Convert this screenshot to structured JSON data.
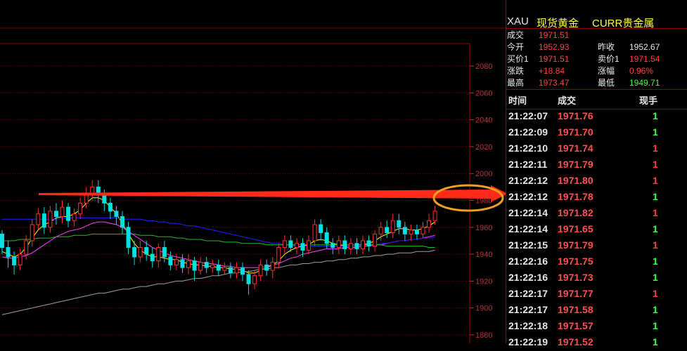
{
  "chart_data": {
    "type": "candlestick",
    "ylim": [
      1880,
      2100
    ],
    "yticks": [
      "2080",
      "2060",
      "2040",
      "2020",
      "2000",
      "1980",
      "1960",
      "1940",
      "1920",
      "1900",
      "1880"
    ],
    "grid": true,
    "candles": [
      [
        1955,
        1945,
        1958,
        1940
      ],
      [
        1945,
        1938,
        1950,
        1930
      ],
      [
        1938,
        1932,
        1942,
        1925
      ],
      [
        1932,
        1940,
        1944,
        1928
      ],
      [
        1940,
        1950,
        1954,
        1936
      ],
      [
        1950,
        1962,
        1966,
        1946
      ],
      [
        1962,
        1970,
        1974,
        1958
      ],
      [
        1970,
        1960,
        1975,
        1955
      ],
      [
        1960,
        1972,
        1976,
        1956
      ],
      [
        1972,
        1968,
        1978,
        1962
      ],
      [
        1968,
        1975,
        1980,
        1963
      ],
      [
        1975,
        1965,
        1978,
        1960
      ],
      [
        1965,
        1970,
        1974,
        1961
      ],
      [
        1970,
        1978,
        1982,
        1966
      ],
      [
        1978,
        1985,
        1990,
        1974
      ],
      [
        1985,
        1990,
        1995,
        1980
      ],
      [
        1990,
        1984,
        1995,
        1978
      ],
      [
        1984,
        1978,
        1988,
        1972
      ],
      [
        1978,
        1972,
        1982,
        1966
      ],
      [
        1972,
        1968,
        1976,
        1962
      ],
      [
        1968,
        1960,
        1972,
        1955
      ],
      [
        1960,
        1945,
        1964,
        1940
      ],
      [
        1945,
        1938,
        1950,
        1932
      ],
      [
        1938,
        1945,
        1950,
        1934
      ],
      [
        1945,
        1940,
        1950,
        1935
      ],
      [
        1940,
        1935,
        1945,
        1930
      ],
      [
        1935,
        1945,
        1948,
        1930
      ],
      [
        1945,
        1938,
        1950,
        1934
      ],
      [
        1938,
        1932,
        1942,
        1928
      ],
      [
        1932,
        1936,
        1940,
        1928
      ],
      [
        1936,
        1930,
        1940,
        1926
      ],
      [
        1930,
        1935,
        1940,
        1925
      ],
      [
        1935,
        1928,
        1938,
        1920
      ],
      [
        1928,
        1934,
        1938,
        1925
      ],
      [
        1934,
        1930,
        1938,
        1926
      ],
      [
        1930,
        1932,
        1936,
        1926
      ],
      [
        1932,
        1928,
        1936,
        1924
      ],
      [
        1928,
        1930,
        1934,
        1925
      ],
      [
        1930,
        1926,
        1934,
        1922
      ],
      [
        1926,
        1930,
        1934,
        1922
      ],
      [
        1930,
        1925,
        1934,
        1920
      ],
      [
        1925,
        1918,
        1928,
        1910
      ],
      [
        1918,
        1924,
        1928,
        1914
      ],
      [
        1924,
        1932,
        1936,
        1920
      ],
      [
        1932,
        1928,
        1936,
        1924
      ],
      [
        1928,
        1934,
        1938,
        1922
      ],
      [
        1934,
        1945,
        1948,
        1930
      ],
      [
        1945,
        1950,
        1954,
        1940
      ],
      [
        1950,
        1945,
        1954,
        1942
      ],
      [
        1945,
        1948,
        1952,
        1940
      ],
      [
        1948,
        1943,
        1952,
        1938
      ],
      [
        1943,
        1950,
        1954,
        1940
      ],
      [
        1950,
        1962,
        1966,
        1946
      ],
      [
        1962,
        1956,
        1966,
        1950
      ],
      [
        1956,
        1948,
        1960,
        1944
      ],
      [
        1948,
        1945,
        1952,
        1940
      ],
      [
        1945,
        1950,
        1954,
        1940
      ],
      [
        1950,
        1944,
        1954,
        1940
      ],
      [
        1944,
        1948,
        1952,
        1940
      ],
      [
        1948,
        1944,
        1952,
        1940
      ],
      [
        1944,
        1950,
        1954,
        1940
      ],
      [
        1950,
        1946,
        1954,
        1942
      ],
      [
        1946,
        1955,
        1958,
        1942
      ],
      [
        1955,
        1960,
        1964,
        1950
      ],
      [
        1960,
        1956,
        1965,
        1952
      ],
      [
        1956,
        1965,
        1970,
        1952
      ],
      [
        1965,
        1960,
        1970,
        1955
      ],
      [
        1960,
        1955,
        1964,
        1950
      ],
      [
        1955,
        1958,
        1962,
        1950
      ],
      [
        1958,
        1955,
        1962,
        1951
      ],
      [
        1955,
        1960,
        1964,
        1952
      ],
      [
        1960,
        1965,
        1970,
        1956
      ],
      [
        1965,
        1972,
        1976,
        1962
      ]
    ],
    "series": [
      {
        "color": "#ffff00",
        "values": [
          1942,
          1940,
          1938,
          1940,
          1945,
          1952,
          1958,
          1962,
          1964,
          1967,
          1968,
          1968,
          1970,
          1973,
          1978,
          1982,
          1982,
          1980,
          1975,
          1970,
          1963,
          1955,
          1948,
          1943,
          1940,
          1938,
          1938,
          1937,
          1936,
          1936,
          1934,
          1933,
          1932,
          1932,
          1931,
          1931,
          1930,
          1930,
          1929,
          1929,
          1928,
          1926,
          1926,
          1928,
          1930,
          1932,
          1935,
          1940,
          1943,
          1945,
          1946,
          1947,
          1950,
          1951,
          1950,
          1948,
          1947,
          1946,
          1946,
          1946,
          1947,
          1948,
          1950,
          1953,
          1955,
          1957,
          1959,
          1959,
          1958,
          1958,
          1959,
          1961,
          1964
        ]
      },
      {
        "color": "#ff40ff",
        "values": [
          1938,
          1937,
          1937,
          1938,
          1939,
          1941,
          1944,
          1947,
          1950,
          1953,
          1955,
          1957,
          1958,
          1959,
          1961,
          1963,
          1964,
          1964,
          1963,
          1962,
          1960,
          1957,
          1954,
          1951,
          1948,
          1945,
          1943,
          1941,
          1939,
          1938,
          1937,
          1936,
          1935,
          1934,
          1933,
          1933,
          1932,
          1931,
          1931,
          1930,
          1930,
          1930,
          1930,
          1930,
          1931,
          1932,
          1933,
          1935,
          1937,
          1938,
          1940,
          1941,
          1942,
          1943,
          1944,
          1944,
          1944,
          1945,
          1945,
          1945,
          1946,
          1946,
          1947,
          1947,
          1948,
          1949,
          1950,
          1950,
          1951,
          1951,
          1952,
          1953,
          1954
        ]
      },
      {
        "color": "#2020ff",
        "values": [
          1966,
          1966,
          1966,
          1966,
          1966,
          1966,
          1966,
          1966,
          1966,
          1966,
          1967,
          1967,
          1967,
          1967,
          1967,
          1967,
          1967,
          1967,
          1967,
          1967,
          1966,
          1966,
          1966,
          1966,
          1965,
          1965,
          1964,
          1964,
          1963,
          1963,
          1962,
          1961,
          1961,
          1960,
          1959,
          1958,
          1957,
          1956,
          1955,
          1954,
          1953,
          1952,
          1951,
          1950,
          1949,
          1948,
          1948,
          1947,
          1947,
          1946,
          1946,
          1946,
          1946,
          1946,
          1946,
          1946,
          1946,
          1946,
          1946,
          1946,
          1947,
          1947,
          1947,
          1948,
          1948,
          1949,
          1950,
          1950,
          1951,
          1951,
          1952,
          1952,
          1953
        ]
      },
      {
        "color": "#20c020",
        "values": [
          1950,
          1950,
          1950,
          1951,
          1951,
          1951,
          1952,
          1952,
          1952,
          1953,
          1953,
          1953,
          1954,
          1954,
          1954,
          1955,
          1955,
          1955,
          1955,
          1955,
          1955,
          1955,
          1955,
          1954,
          1954,
          1954,
          1953,
          1953,
          1953,
          1952,
          1952,
          1951,
          1951,
          1951,
          1950,
          1950,
          1950,
          1949,
          1949,
          1949,
          1948,
          1948,
          1948,
          1948,
          1947,
          1947,
          1947,
          1947,
          1947,
          1947,
          1947,
          1947,
          1947,
          1947,
          1947,
          1947,
          1947,
          1947,
          1947,
          1947,
          1947,
          1947,
          1947,
          1947,
          1946,
          1946,
          1946,
          1946,
          1946,
          1946,
          1946,
          1945,
          1945
        ]
      },
      {
        "color": "#a0a0a0",
        "values": [
          1895,
          1896,
          1897,
          1898,
          1899,
          1900,
          1901,
          1902,
          1903,
          1904,
          1905,
          1906,
          1907,
          1908,
          1909,
          1910,
          1911,
          1911,
          1912,
          1913,
          1914,
          1914,
          1915,
          1916,
          1916,
          1917,
          1918,
          1918,
          1919,
          1920,
          1920,
          1921,
          1922,
          1922,
          1923,
          1924,
          1924,
          1925,
          1926,
          1926,
          1927,
          1927,
          1928,
          1929,
          1929,
          1930,
          1930,
          1931,
          1932,
          1932,
          1933,
          1933,
          1934,
          1934,
          1935,
          1935,
          1936,
          1936,
          1937,
          1937,
          1938,
          1938,
          1939,
          1939,
          1940,
          1940,
          1941,
          1941,
          1941,
          1942,
          1942,
          1942,
          1943
        ]
      }
    ]
  },
  "quote": {
    "symbol": "XAU",
    "name": "现货黄金",
    "category": "CURR贵金属",
    "last_label": "成交",
    "last": "1971.51",
    "open_label": "今开",
    "open": "1952.93",
    "prev_label": "昨收",
    "prev": "1952.67",
    "bid_label": "买价1",
    "bid": "1971.51",
    "ask_label": "卖价1",
    "ask": "1971.54",
    "change_label": "涨跌",
    "change": "+18.84",
    "pct_label": "涨幅",
    "pct": "0.96%",
    "high_label": "最高",
    "high": "1973.47",
    "low_label": "最低",
    "low": "1949.71"
  },
  "ticks_header": {
    "time": "时间",
    "price": "成交",
    "vol": "现手"
  },
  "ticks": [
    {
      "time": "21:22:07",
      "price": "1971.76",
      "vol": "1",
      "dir": "green"
    },
    {
      "time": "21:22:09",
      "price": "1971.70",
      "vol": "1",
      "dir": "green"
    },
    {
      "time": "21:22:10",
      "price": "1971.74",
      "vol": "1",
      "dir": "red"
    },
    {
      "time": "21:22:11",
      "price": "1971.79",
      "vol": "1",
      "dir": "red"
    },
    {
      "time": "21:22:12",
      "price": "1971.80",
      "vol": "1",
      "dir": "red"
    },
    {
      "time": "21:22:12",
      "price": "1971.78",
      "vol": "1",
      "dir": "green"
    },
    {
      "time": "21:22:14",
      "price": "1971.82",
      "vol": "1",
      "dir": "red"
    },
    {
      "time": "21:22:14",
      "price": "1971.65",
      "vol": "1",
      "dir": "green"
    },
    {
      "time": "21:22:15",
      "price": "1971.79",
      "vol": "1",
      "dir": "red"
    },
    {
      "time": "21:22:16",
      "price": "1971.75",
      "vol": "1",
      "dir": "green"
    },
    {
      "time": "21:22:16",
      "price": "1971.73",
      "vol": "1",
      "dir": "green"
    },
    {
      "time": "21:22:17",
      "price": "1971.77",
      "vol": "1",
      "dir": "red"
    },
    {
      "time": "21:22:17",
      "price": "1971.58",
      "vol": "1",
      "dir": "green"
    },
    {
      "time": "21:22:18",
      "price": "1971.57",
      "vol": "1",
      "dir": "green"
    },
    {
      "time": "21:22:19",
      "price": "1971.52",
      "vol": "1",
      "dir": "green"
    }
  ],
  "colors": {
    "up": "#ff3030",
    "down": "#00e0e0",
    "grid": "#8b0000",
    "axis": "#c03030",
    "annotation": "#ff2a1a",
    "ellipse": "#f0a020"
  }
}
